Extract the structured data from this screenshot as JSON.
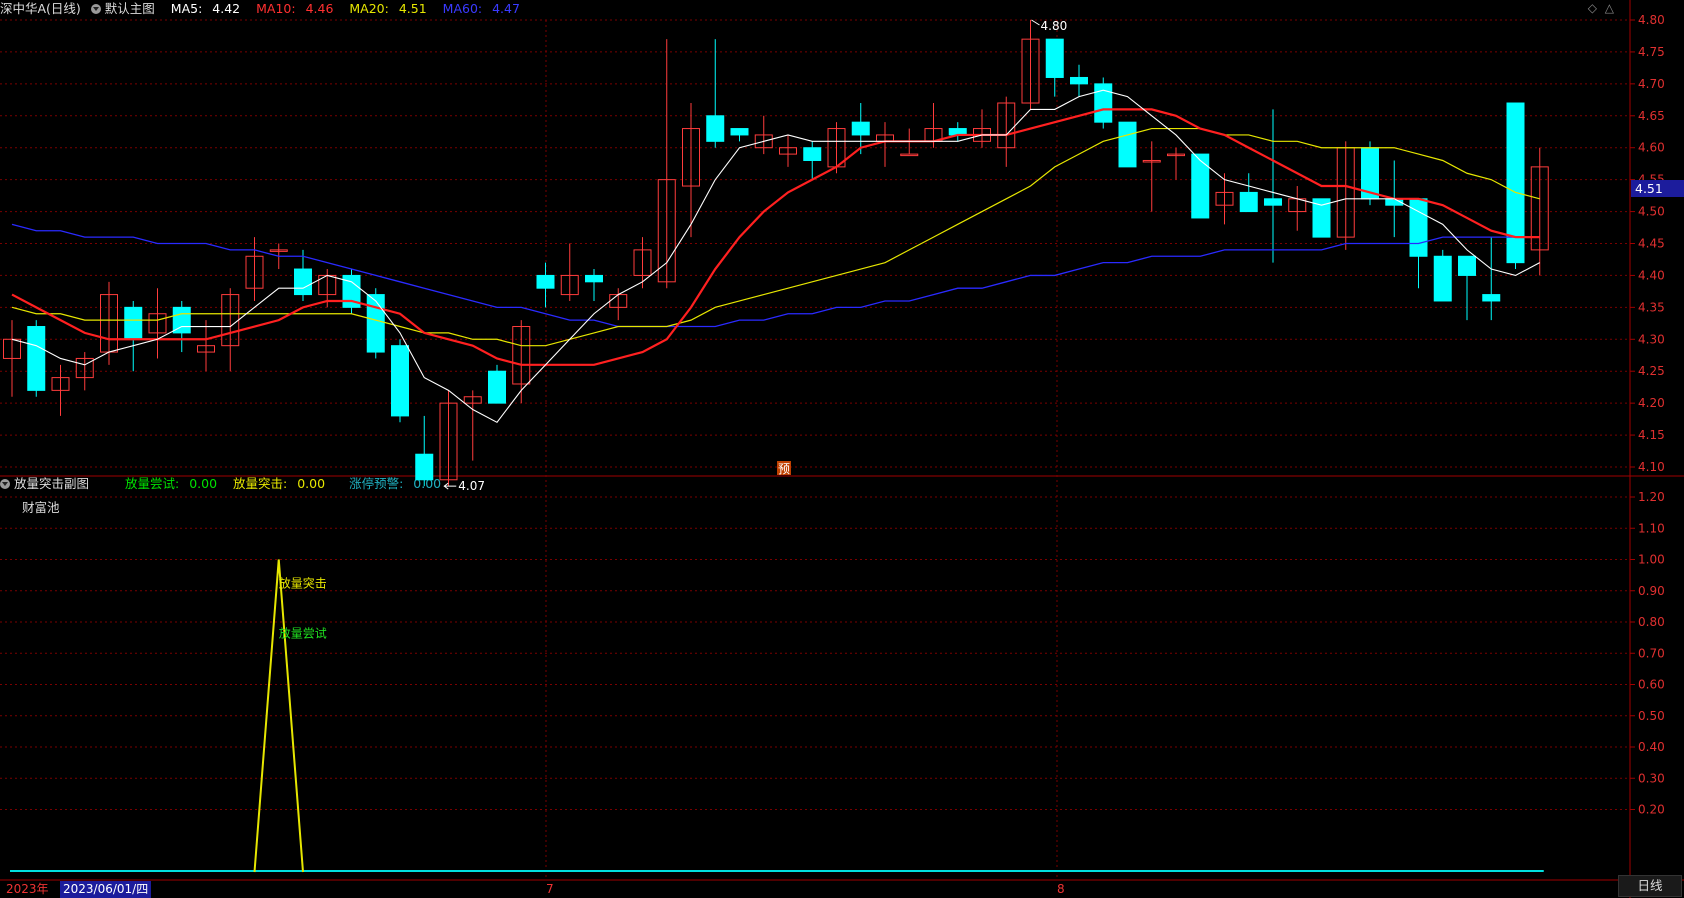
{
  "main_header": {
    "stock": "深中华A(日线)",
    "template": "默认主图",
    "ma5_label": "MA5:",
    "ma5_value": "4.42",
    "ma10_label": "MA10:",
    "ma10_value": "4.46",
    "ma20_label": "MA20:",
    "ma20_value": "4.51",
    "ma60_label": "MA60:",
    "ma60_value": "4.47"
  },
  "sub_header": {
    "title": "放量突击副图",
    "f1_label": "放量尝试:",
    "f1_value": "0.00",
    "f2_label": "放量突击:",
    "f2_value": "0.00",
    "f3_label": "涨停预警:",
    "f3_value": "0.00",
    "pool": "财富池"
  },
  "annotations": {
    "high": "4.80",
    "low": "4.07",
    "pre": "预",
    "peak_label_1": "放量突击",
    "peak_label_2": "放量尝试"
  },
  "current_price": "4.51",
  "bottom": {
    "year": "2023年",
    "cursor_date": "2023/06/01/四",
    "month_7": "7",
    "month_8": "8",
    "period_button": "日线"
  },
  "top_icons": {
    "diamond": "◇",
    "up": "△"
  },
  "colors": {
    "up": "#ff3c3c",
    "down": "#00ffff",
    "ma5": "#ffffff",
    "ma10": "#ff2020",
    "ma20": "#e6e600",
    "ma60": "#2a2aff",
    "grid": "#7a0000"
  },
  "chart_data": [
    {
      "type": "candlestick",
      "ylim": [
        4.05,
        4.82
      ],
      "yticks": [
        "4.80",
        "4.75",
        "4.70",
        "4.65",
        "4.60",
        "4.55",
        "4.50",
        "4.45",
        "4.40",
        "4.35",
        "4.30",
        "4.25",
        "4.20",
        "4.15",
        "4.10"
      ],
      "candles": [
        [
          4.27,
          4.3,
          4.33,
          4.21
        ],
        [
          4.32,
          4.22,
          4.33,
          4.21
        ],
        [
          4.22,
          4.24,
          4.26,
          4.18
        ],
        [
          4.24,
          4.27,
          4.28,
          4.22
        ],
        [
          4.28,
          4.37,
          4.39,
          4.26
        ],
        [
          4.35,
          4.3,
          4.36,
          4.25
        ],
        [
          4.31,
          4.34,
          4.38,
          4.27
        ],
        [
          4.35,
          4.31,
          4.36,
          4.28
        ],
        [
          4.28,
          4.29,
          4.33,
          4.25
        ],
        [
          4.29,
          4.37,
          4.38,
          4.25
        ],
        [
          4.38,
          4.43,
          4.46,
          4.36
        ],
        [
          4.44,
          4.44,
          4.45,
          4.41
        ],
        [
          4.41,
          4.37,
          4.44,
          4.36
        ],
        [
          4.37,
          4.4,
          4.41,
          4.35
        ],
        [
          4.4,
          4.35,
          4.41,
          4.34
        ],
        [
          4.37,
          4.28,
          4.38,
          4.27
        ],
        [
          4.29,
          4.18,
          4.3,
          4.17
        ],
        [
          4.12,
          4.08,
          4.18,
          4.07
        ],
        [
          4.08,
          4.2,
          4.22,
          4.07
        ],
        [
          4.2,
          4.21,
          4.22,
          4.11
        ],
        [
          4.25,
          4.2,
          4.26,
          4.2
        ],
        [
          4.23,
          4.32,
          4.33,
          4.2
        ],
        [
          4.4,
          4.38,
          4.42,
          4.35
        ],
        [
          4.37,
          4.4,
          4.45,
          4.36
        ],
        [
          4.4,
          4.39,
          4.41,
          4.36
        ],
        [
          4.35,
          4.37,
          4.38,
          4.33
        ],
        [
          4.4,
          4.44,
          4.46,
          4.38
        ],
        [
          4.39,
          4.55,
          4.77,
          4.38
        ],
        [
          4.54,
          4.63,
          4.67,
          4.46
        ],
        [
          4.65,
          4.61,
          4.77,
          4.6
        ],
        [
          4.63,
          4.62,
          4.63,
          4.61
        ],
        [
          4.6,
          4.62,
          4.65,
          4.59
        ],
        [
          4.59,
          4.6,
          4.62,
          4.57
        ],
        [
          4.6,
          4.58,
          4.61,
          4.55
        ],
        [
          4.57,
          4.63,
          4.64,
          4.56
        ],
        [
          4.64,
          4.62,
          4.67,
          4.59
        ],
        [
          4.61,
          4.62,
          4.64,
          4.57
        ],
        [
          4.59,
          4.59,
          4.63,
          4.59
        ],
        [
          4.61,
          4.63,
          4.67,
          4.6
        ],
        [
          4.63,
          4.62,
          4.64,
          4.61
        ],
        [
          4.61,
          4.63,
          4.66,
          4.6
        ],
        [
          4.6,
          4.67,
          4.68,
          4.57
        ],
        [
          4.67,
          4.77,
          4.8,
          4.66
        ],
        [
          4.77,
          4.71,
          4.77,
          4.68
        ],
        [
          4.71,
          4.7,
          4.73,
          4.68
        ],
        [
          4.7,
          4.64,
          4.71,
          4.63
        ],
        [
          4.64,
          4.57,
          4.64,
          4.57
        ],
        [
          4.58,
          4.58,
          4.61,
          4.5
        ],
        [
          4.59,
          4.59,
          4.6,
          4.55
        ],
        [
          4.59,
          4.49,
          4.59,
          4.49
        ],
        [
          4.51,
          4.53,
          4.56,
          4.48
        ],
        [
          4.53,
          4.5,
          4.56,
          4.5
        ],
        [
          4.52,
          4.51,
          4.66,
          4.42
        ],
        [
          4.5,
          4.52,
          4.54,
          4.47
        ],
        [
          4.52,
          4.46,
          4.52,
          4.46
        ],
        [
          4.46,
          4.6,
          4.61,
          4.44
        ],
        [
          4.6,
          4.52,
          4.61,
          4.51
        ],
        [
          4.52,
          4.51,
          4.58,
          4.46
        ],
        [
          4.52,
          4.43,
          4.52,
          4.38
        ],
        [
          4.43,
          4.36,
          4.44,
          4.36
        ],
        [
          4.43,
          4.4,
          4.43,
          4.33
        ],
        [
          4.37,
          4.36,
          4.46,
          4.33
        ],
        [
          4.67,
          4.42,
          4.67,
          4.41
        ],
        [
          4.44,
          4.57,
          4.6,
          4.4
        ]
      ],
      "ma5": [
        4.3,
        4.29,
        4.27,
        4.26,
        4.28,
        4.29,
        4.3,
        4.32,
        4.32,
        4.32,
        4.35,
        4.38,
        4.38,
        4.4,
        4.39,
        4.36,
        4.31,
        4.24,
        4.22,
        4.19,
        4.17,
        4.22,
        4.26,
        4.3,
        4.34,
        4.37,
        4.39,
        4.42,
        4.48,
        4.55,
        4.6,
        4.61,
        4.62,
        4.61,
        4.61,
        4.61,
        4.61,
        4.61,
        4.61,
        4.61,
        4.62,
        4.62,
        4.66,
        4.66,
        4.68,
        4.69,
        4.68,
        4.65,
        4.62,
        4.58,
        4.55,
        4.54,
        4.53,
        4.52,
        4.51,
        4.52,
        4.52,
        4.52,
        4.5,
        4.48,
        4.44,
        4.41,
        4.4,
        4.42
      ],
      "ma10": [
        4.37,
        4.35,
        4.33,
        4.31,
        4.3,
        4.3,
        4.3,
        4.3,
        4.3,
        4.31,
        4.32,
        4.33,
        4.35,
        4.36,
        4.36,
        4.35,
        4.34,
        4.31,
        4.3,
        4.29,
        4.27,
        4.26,
        4.26,
        4.26,
        4.26,
        4.27,
        4.28,
        4.3,
        4.35,
        4.41,
        4.46,
        4.5,
        4.53,
        4.55,
        4.57,
        4.6,
        4.61,
        4.61,
        4.61,
        4.62,
        4.62,
        4.62,
        4.63,
        4.64,
        4.65,
        4.66,
        4.66,
        4.66,
        4.65,
        4.63,
        4.62,
        4.6,
        4.58,
        4.56,
        4.54,
        4.54,
        4.53,
        4.52,
        4.52,
        4.51,
        4.49,
        4.47,
        4.46,
        4.46
      ],
      "ma20": [
        4.35,
        4.34,
        4.34,
        4.33,
        4.33,
        4.33,
        4.33,
        4.34,
        4.34,
        4.34,
        4.34,
        4.34,
        4.34,
        4.34,
        4.34,
        4.33,
        4.32,
        4.31,
        4.31,
        4.3,
        4.3,
        4.29,
        4.29,
        4.3,
        4.31,
        4.32,
        4.32,
        4.32,
        4.33,
        4.35,
        4.36,
        4.37,
        4.38,
        4.39,
        4.4,
        4.41,
        4.42,
        4.44,
        4.46,
        4.48,
        4.5,
        4.52,
        4.54,
        4.57,
        4.59,
        4.61,
        4.62,
        4.63,
        4.63,
        4.63,
        4.62,
        4.62,
        4.61,
        4.61,
        4.6,
        4.6,
        4.6,
        4.6,
        4.59,
        4.58,
        4.56,
        4.55,
        4.53,
        4.52
      ],
      "ma60": [
        4.48,
        4.47,
        4.47,
        4.46,
        4.46,
        4.46,
        4.45,
        4.45,
        4.45,
        4.44,
        4.44,
        4.43,
        4.43,
        4.42,
        4.41,
        4.4,
        4.39,
        4.38,
        4.37,
        4.36,
        4.35,
        4.35,
        4.34,
        4.33,
        4.33,
        4.32,
        4.32,
        4.32,
        4.32,
        4.32,
        4.33,
        4.33,
        4.34,
        4.34,
        4.35,
        4.35,
        4.36,
        4.36,
        4.37,
        4.38,
        4.38,
        4.39,
        4.4,
        4.4,
        4.41,
        4.42,
        4.42,
        4.43,
        4.43,
        4.43,
        4.44,
        4.44,
        4.44,
        4.44,
        4.44,
        4.45,
        4.45,
        4.45,
        4.45,
        4.46,
        4.46,
        4.46,
        4.46,
        4.46
      ]
    },
    {
      "type": "line",
      "ylim": [
        0,
        1.25
      ],
      "yticks": [
        "1.20",
        "1.10",
        "1.00",
        "0.90",
        "0.80",
        "0.70",
        "0.60",
        "0.50",
        "0.40",
        "0.30",
        "0.20"
      ],
      "signal": [
        0,
        0,
        0,
        0,
        0,
        0,
        0,
        0,
        0,
        0,
        0,
        1,
        0,
        0,
        0,
        0,
        0,
        0,
        0,
        0,
        0,
        0,
        0,
        0,
        0,
        0,
        0,
        0,
        0,
        0,
        0,
        0,
        0,
        0,
        0,
        0,
        0,
        0,
        0,
        0,
        0,
        0,
        0,
        0,
        0,
        0,
        0,
        0,
        0,
        0,
        0,
        0,
        0,
        0,
        0,
        0,
        0,
        0,
        0,
        0,
        0,
        0,
        0,
        0
      ],
      "baseline": 0
    }
  ]
}
